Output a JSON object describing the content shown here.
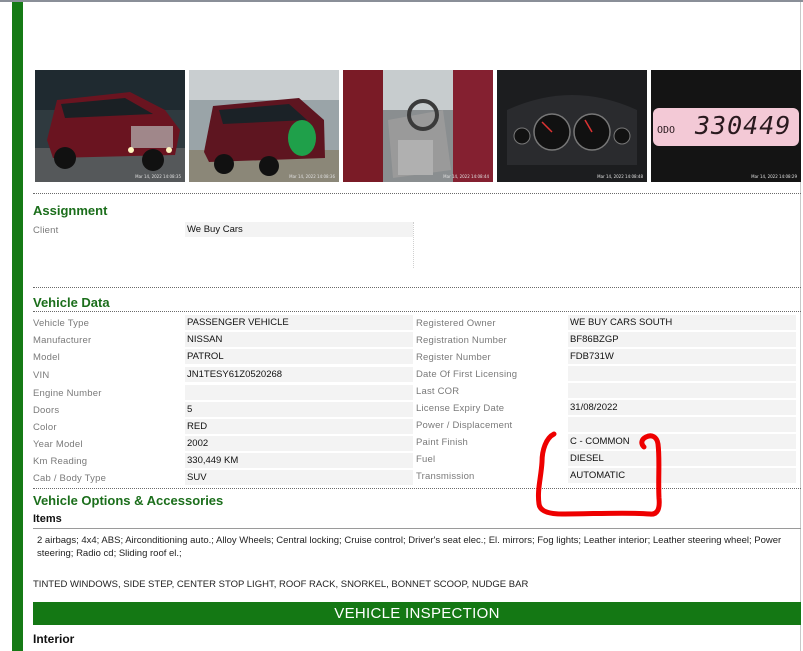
{
  "photos": [
    {
      "alt": "vehicle-front-exterior",
      "timestamp": "Mar 14, 2022 14:08:35"
    },
    {
      "alt": "vehicle-rear-exterior",
      "timestamp": "Mar 14, 2022 14:08:36"
    },
    {
      "alt": "vehicle-interior",
      "timestamp": "Mar 14, 2022 14:08:44"
    },
    {
      "alt": "instrument-cluster",
      "timestamp": "Mar 14, 2022 14:08:48"
    },
    {
      "alt": "odometer-display",
      "timestamp": "Mar 14, 2022 14:08:29",
      "odo_label": "ODO",
      "odo_value": "330449"
    }
  ],
  "assignment": {
    "title": "Assignment",
    "client_label": "Client",
    "client_value": "We Buy Cars"
  },
  "vehicle_data": {
    "title": "Vehicle Data",
    "left": [
      {
        "label": "Vehicle Type",
        "value": "PASSENGER VEHICLE"
      },
      {
        "label": "Manufacturer",
        "value": "NISSAN"
      },
      {
        "label": "Model",
        "value": "PATROL"
      },
      {
        "label": "VIN",
        "value": "JN1TESY61Z0520268"
      },
      {
        "label": "Engine Number",
        "value": ""
      },
      {
        "label": "Doors",
        "value": "5"
      },
      {
        "label": "Color",
        "value": "RED"
      },
      {
        "label": "Year Model",
        "value": "2002"
      },
      {
        "label": "Km Reading",
        "value": "330,449  KM"
      },
      {
        "label": "Cab / Body Type",
        "value": "SUV"
      }
    ],
    "right": [
      {
        "label": "Registered Owner",
        "value": "WE BUY CARS SOUTH"
      },
      {
        "label": "Registration Number",
        "value": "BF86BZGP"
      },
      {
        "label": "Register Number",
        "value": "FDB731W"
      },
      {
        "label": "Date Of First Licensing",
        "value": ""
      },
      {
        "label": "Last COR",
        "value": ""
      },
      {
        "label": "License Expiry Date",
        "value": "31/08/2022"
      },
      {
        "label": "Power / Displacement",
        "value": ""
      },
      {
        "label": "Paint Finish",
        "value": "C - COMMON"
      },
      {
        "label": "Fuel",
        "value": "DIESEL"
      },
      {
        "label": "Transmission",
        "value": "AUTOMATIC"
      }
    ]
  },
  "options": {
    "title": "Vehicle Options & Accessories",
    "items_title": "Items",
    "items_text": "2 airbags; 4x4; ABS; Airconditioning auto.; Alloy Wheels; Central locking; Cruise control; Driver's seat elec.; El. mirrors; Fog lights; Leather interior; Leather steering wheel; Power steering; Radio cd; Sliding roof el.;",
    "extras_text": "TINTED WINDOWS, SIDE STEP, CENTER STOP LIGHT, ROOF RACK, SNORKEL, BONNET SCOOP, NUDGE BAR"
  },
  "inspection": {
    "banner": "VEHICLE INSPECTION",
    "interior_title": "Interior"
  },
  "colors": {
    "accent_green": "#157a15",
    "section_title": "#1b6e1b",
    "annotation_red": "#ee0000"
  }
}
